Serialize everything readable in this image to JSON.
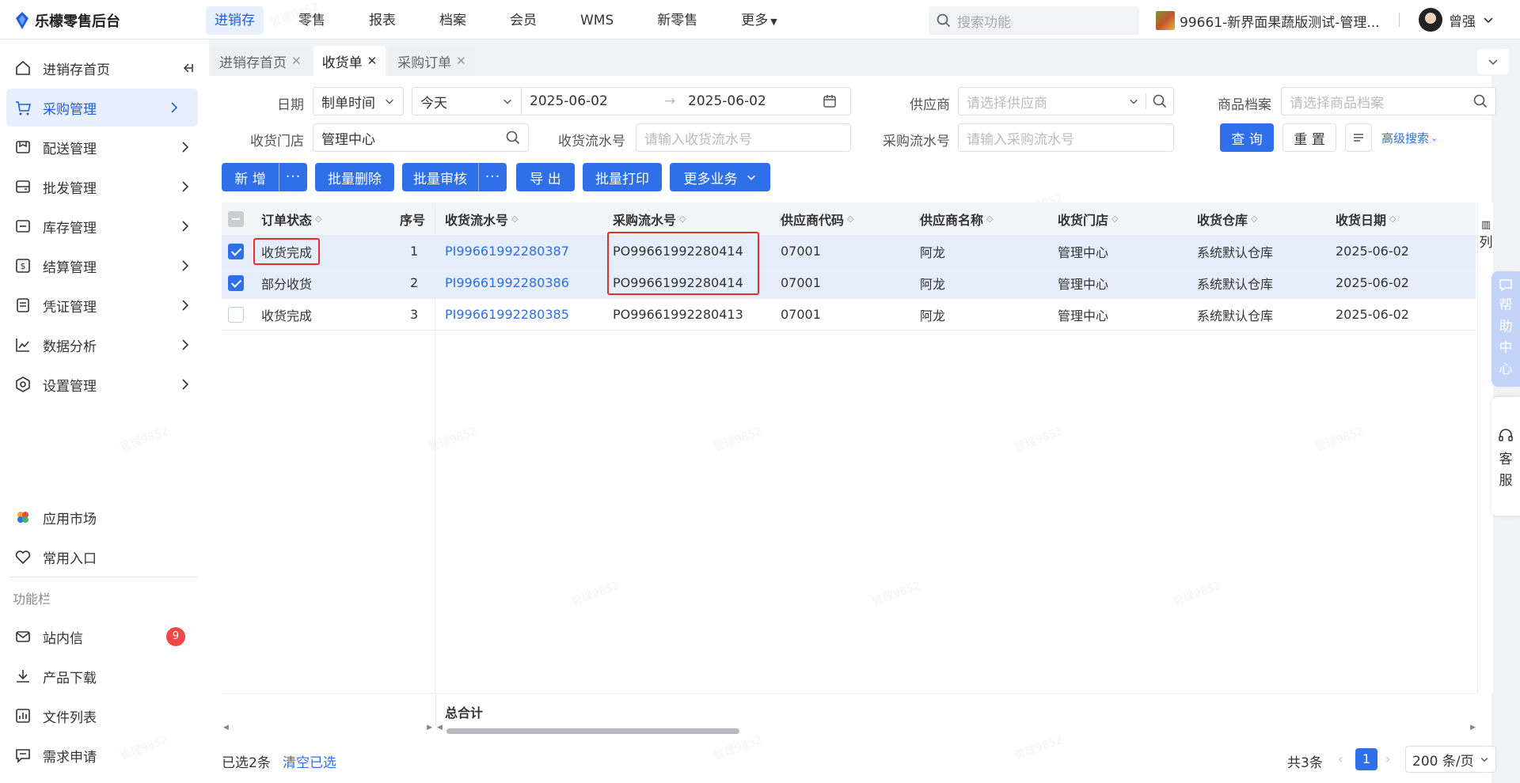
{
  "header": {
    "logo": "乐檬零售后台",
    "nav": [
      "进销存",
      "零售",
      "报表",
      "档案",
      "会员",
      "WMS",
      "新零售",
      "更多"
    ],
    "search_placeholder": "搜索功能",
    "store": "99661-新界面果蔬版测试-管理...",
    "user": "曾强"
  },
  "sidebar": {
    "items": [
      "进销存首页",
      "采购管理",
      "配送管理",
      "批发管理",
      "库存管理",
      "结算管理",
      "凭证管理",
      "数据分析",
      "设置管理"
    ],
    "bottom": [
      "应用市场",
      "常用入口"
    ],
    "group_title": "功能栏",
    "tools": [
      "站内信",
      "产品下载",
      "文件列表",
      "需求申请"
    ],
    "badge": "9"
  },
  "tabs": [
    "进销存首页",
    "收货单",
    "采购订单"
  ],
  "filters": {
    "date_label": "日期",
    "date_type": "制单时间",
    "date_range": "今天",
    "date_start": "2025-06-02",
    "date_end": "2025-06-02",
    "supplier_label": "供应商",
    "supplier_ph": "请选择供应商",
    "goods_label": "商品档案",
    "goods_ph": "请选择商品档案",
    "store_label": "收货门店",
    "store_value": "管理中心",
    "recv_label": "收货流水号",
    "recv_ph": "请输入收货流水号",
    "po_label": "采购流水号",
    "po_ph": "请输入采购流水号",
    "query": "查 询",
    "reset": "重 置",
    "advanced": "高级搜索"
  },
  "toolbar": {
    "add": "新 增",
    "batch_delete": "批量删除",
    "batch_audit": "批量审核",
    "export": "导 出",
    "batch_print": "批量打印",
    "more": "更多业务",
    "dots": "···"
  },
  "table": {
    "columns": [
      "订单状态",
      "序号",
      "收货流水号",
      "采购流水号",
      "供应商代码",
      "供应商名称",
      "收货门店",
      "收货仓库",
      "收货日期"
    ],
    "rows": [
      {
        "status": "收货完成",
        "no": "1",
        "recv": "PI99661992280387",
        "po": "PO99661992280414",
        "code": "07001",
        "name": "阿龙",
        "store": "管理中心",
        "wh": "系统默认仓库",
        "date": "2025-06-02"
      },
      {
        "status": "部分收货",
        "no": "2",
        "recv": "PI99661992280386",
        "po": "PO99661992280414",
        "code": "07001",
        "name": "阿龙",
        "store": "管理中心",
        "wh": "系统默认仓库",
        "date": "2025-06-02"
      },
      {
        "status": "收货完成",
        "no": "3",
        "recv": "PI99661992280385",
        "po": "PO99661992280413",
        "code": "07001",
        "name": "阿龙",
        "store": "管理中心",
        "wh": "系统默认仓库",
        "date": "2025-06-02"
      }
    ],
    "total_label": "总合计",
    "col_setting": "列"
  },
  "pagination": {
    "selected": "已选2条",
    "clear": "清空已选",
    "total": "共3条",
    "page": "1",
    "page_size": "200 条/页"
  },
  "float": {
    "help": [
      "帮",
      "助",
      "中",
      "心"
    ],
    "service": [
      "客",
      "服"
    ]
  },
  "colors": {
    "primary": "#2f6fe8",
    "highlight": "#e03131",
    "badge": "#f04848"
  }
}
